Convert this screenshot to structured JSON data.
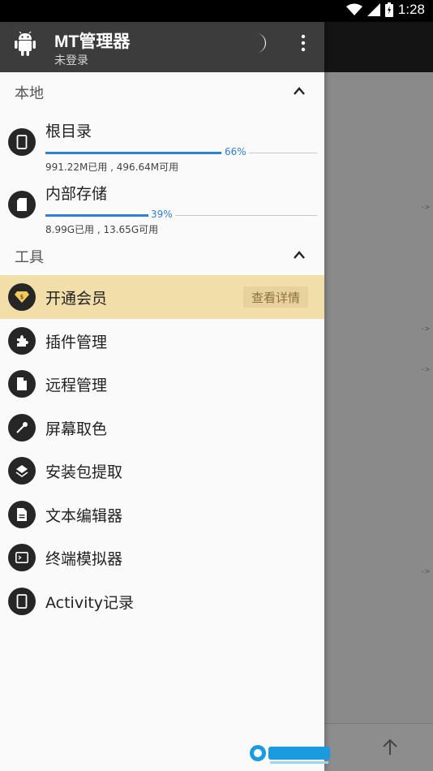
{
  "status_bar": {
    "time": "1:28"
  },
  "header": {
    "title": "MT管理器",
    "user_status": "未登录"
  },
  "local_section": {
    "title": "本地",
    "items": [
      {
        "name": "根目录",
        "percent_label": "66%",
        "fill": 0.66,
        "detail": "991.22M已用 , 496.64M可用",
        "icon": "phone-icon"
      },
      {
        "name": "内部存储",
        "percent_label": "39%",
        "fill": 0.39,
        "detail": "8.99G已用 , 13.65G可用",
        "icon": "sd-card-icon"
      }
    ]
  },
  "tools_section": {
    "title": "工具",
    "vip": {
      "label": "开通会员",
      "button": "查看详情"
    },
    "items": [
      {
        "label": "插件管理",
        "icon": "puzzle-icon"
      },
      {
        "label": "远程管理",
        "icon": "file-icon"
      },
      {
        "label": "屏幕取色",
        "icon": "eyedropper-icon"
      },
      {
        "label": "安装包提取",
        "icon": "layers-icon"
      },
      {
        "label": "文本编辑器",
        "icon": "document-icon"
      },
      {
        "label": "终端模拟器",
        "icon": "terminal-icon"
      },
      {
        "label": "Activity记录",
        "icon": "phone-icon"
      }
    ]
  },
  "background_arrows": [
    "->",
    "->",
    "->",
    "->"
  ],
  "colors": {
    "accent": "#2e7fd6",
    "header_bg": "#3c3c3c",
    "vip_bg": "#f2dea9"
  }
}
